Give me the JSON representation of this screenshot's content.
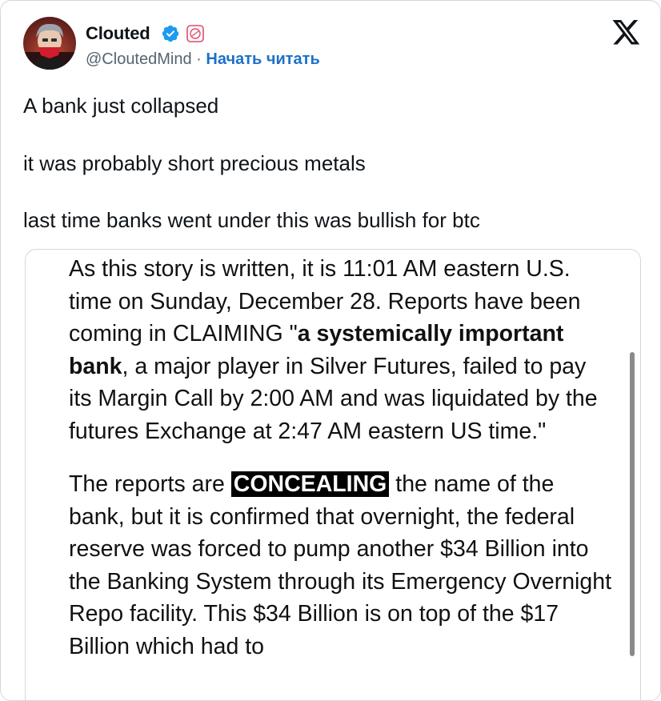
{
  "author": {
    "name": "Clouted",
    "handle": "@CloutedMind",
    "separator": "·",
    "follow_label": "Начать читать",
    "verified_icon": "verified-badge-icon",
    "affiliate_icon": "affiliate-badge-icon"
  },
  "platform_icon": "x-logo-icon",
  "tweet": {
    "lines": [
      "A bank just collapsed",
      "it was probably short precious metals",
      "last time banks went under this was bullish for btc"
    ]
  },
  "media": {
    "paragraph1": {
      "part1": "As this story is written, it is 11:01 AM eastern U.S. time on Sunday, December 28.  Reports have been coming in CLAIMING \"",
      "bold": "a systemically important bank",
      "part2": ", a major player in Silver Futures, failed to pay its Margin Call by 2:00 AM and was liquidated by the futures Exchange at 2:47 AM eastern US time.\""
    },
    "paragraph2": {
      "part1": "The reports are ",
      "highlight": "CONCEALING",
      "part2": " the name of the bank, but it is confirmed that overnight, the federal reserve was forced to pump another $34 Billion into the Banking System through its Emergency Overnight Repo facility.   This $34 Billion is on top of the $17 Billion which had to"
    }
  },
  "colors": {
    "link": "#1d70c9",
    "verified": "#1d9bf0",
    "border": "#cfd9de",
    "secondary_text": "#536471"
  }
}
